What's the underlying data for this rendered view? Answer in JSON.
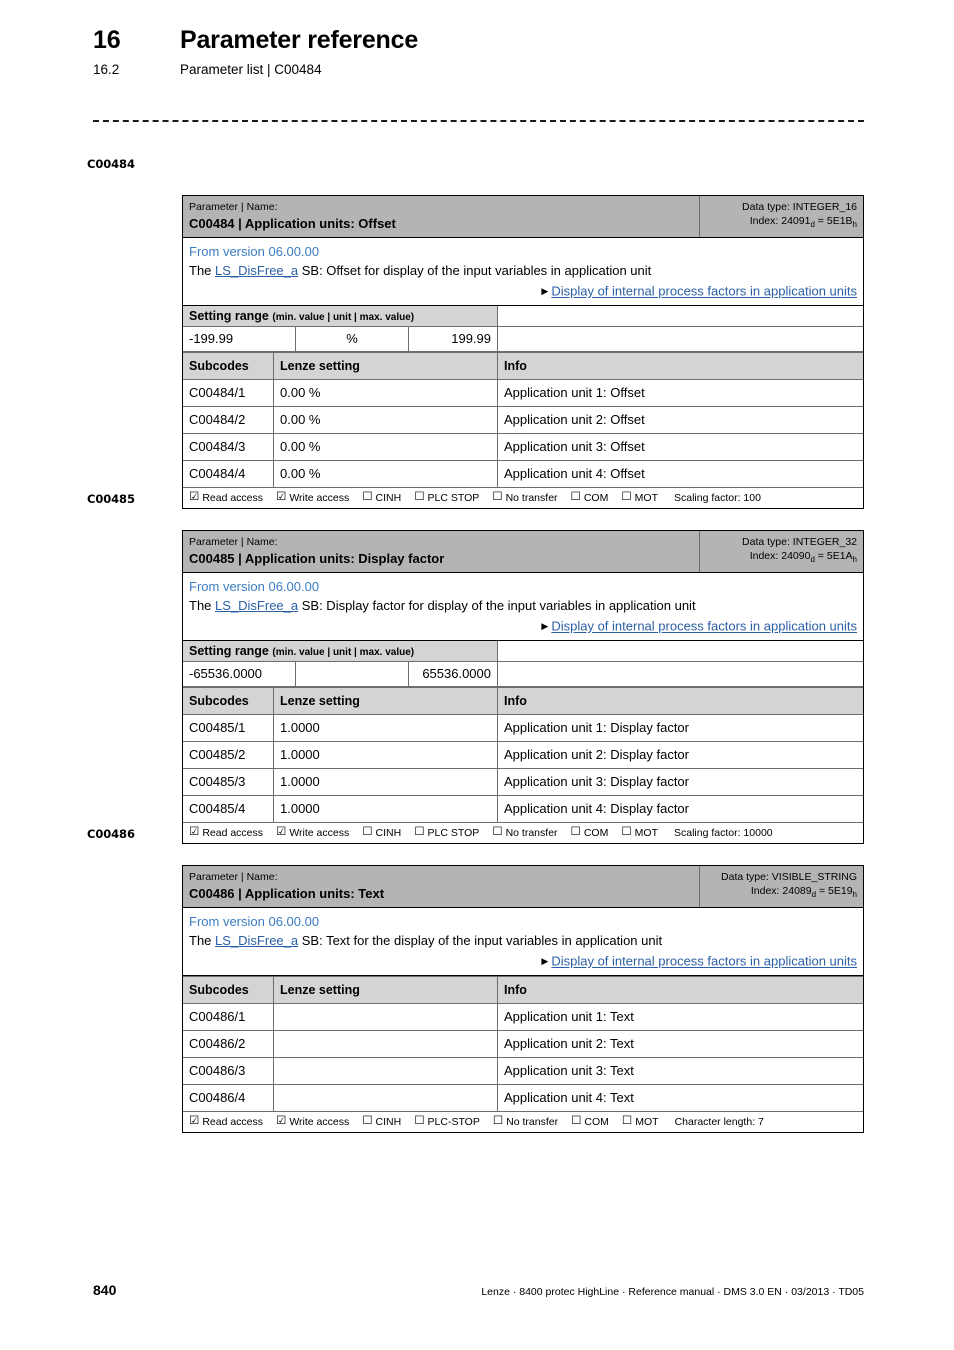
{
  "header": {
    "chapter_number": "16",
    "chapter_title": "Parameter reference",
    "section_number": "16.2",
    "section_title": "Parameter list | C00484"
  },
  "colors": {
    "link_blue": "#2a5fa5",
    "version_blue": "#3b7cc4",
    "head_gray": "#b4b4b4",
    "subhead_gray": "#d4d4d4"
  },
  "blocks": [
    {
      "margin_label": "C00484",
      "head": {
        "kicker": "Parameter | Name:",
        "title": "C00484 | Application units: Offset",
        "data_type_label": "Data type: INTEGER_16",
        "index_prefix": "Index: ",
        "index_dec": "24091",
        "index_dec_sub": "d",
        "index_eq": " = ",
        "index_hex": "5E1B",
        "index_hex_sub": "h"
      },
      "description": {
        "version": "From version 06.00.00",
        "sentence_pre": "The ",
        "sb_link": "LS_DisFree_a",
        "sentence_post": " SB: Offset for display of the input variables in application unit",
        "xref": "Display of internal process factors in application units"
      },
      "setting_range": {
        "label": "Setting range",
        "sublabel": "(min. value | unit | max. value)",
        "min": "-199.99",
        "unit": "%",
        "max": "199.99"
      },
      "subcodes": {
        "columns": [
          "Subcodes",
          "Lenze setting",
          "Info"
        ],
        "rows": [
          [
            "C00484/1",
            "0.00 %",
            "Application unit 1: Offset"
          ],
          [
            "C00484/2",
            "0.00 %",
            "Application unit 2: Offset"
          ],
          [
            "C00484/3",
            "0.00 %",
            "Application unit 3: Offset"
          ],
          [
            "C00484/4",
            "0.00 %",
            "Application unit 4: Offset"
          ]
        ]
      },
      "access": {
        "items": [
          {
            "checked": true,
            "label": "Read access"
          },
          {
            "checked": true,
            "label": "Write access"
          },
          {
            "checked": false,
            "label": "CINH"
          },
          {
            "checked": false,
            "label": "PLC STOP"
          },
          {
            "checked": false,
            "label": "No transfer"
          },
          {
            "checked": false,
            "label": "COM"
          },
          {
            "checked": false,
            "label": "MOT"
          }
        ],
        "note": "Scaling factor: 100"
      }
    },
    {
      "margin_label": "C00485",
      "head": {
        "kicker": "Parameter | Name:",
        "title": "C00485 | Application units: Display factor",
        "data_type_label": "Data type: INTEGER_32",
        "index_prefix": "Index: ",
        "index_dec": "24090",
        "index_dec_sub": "d",
        "index_eq": " = ",
        "index_hex": "5E1A",
        "index_hex_sub": "h"
      },
      "description": {
        "version": "From version 06.00.00",
        "sentence_pre": "The ",
        "sb_link": "LS_DisFree_a",
        "sentence_post": " SB: Display factor for display of the input variables in application unit",
        "xref": "Display of internal process factors in application units"
      },
      "setting_range": {
        "label": "Setting range",
        "sublabel": "(min. value | unit | max. value)",
        "min": "-65536.0000",
        "unit": "",
        "max": "65536.0000"
      },
      "subcodes": {
        "columns": [
          "Subcodes",
          "Lenze setting",
          "Info"
        ],
        "rows": [
          [
            "C00485/1",
            "1.0000",
            "Application unit 1: Display factor"
          ],
          [
            "C00485/2",
            "1.0000",
            "Application unit 2: Display factor"
          ],
          [
            "C00485/3",
            "1.0000",
            "Application unit 3: Display factor"
          ],
          [
            "C00485/4",
            "1.0000",
            "Application unit 4: Display factor"
          ]
        ]
      },
      "access": {
        "items": [
          {
            "checked": true,
            "label": "Read access"
          },
          {
            "checked": true,
            "label": "Write access"
          },
          {
            "checked": false,
            "label": "CINH"
          },
          {
            "checked": false,
            "label": "PLC STOP"
          },
          {
            "checked": false,
            "label": "No transfer"
          },
          {
            "checked": false,
            "label": "COM"
          },
          {
            "checked": false,
            "label": "MOT"
          }
        ],
        "note": "Scaling factor: 10000"
      }
    },
    {
      "margin_label": "C00486",
      "head": {
        "kicker": "Parameter | Name:",
        "title": "C00486 | Application units: Text",
        "data_type_label": "Data type: VISIBLE_STRING",
        "index_prefix": "Index: ",
        "index_dec": "24089",
        "index_dec_sub": "d",
        "index_eq": " = ",
        "index_hex": "5E19",
        "index_hex_sub": "h"
      },
      "description": {
        "version": "From version 06.00.00",
        "sentence_pre": "The ",
        "sb_link": "LS_DisFree_a",
        "sentence_post": " SB: Text for the display of the input variables in application unit",
        "xref": "Display of internal process factors in application units"
      },
      "setting_range": null,
      "subcodes": {
        "columns": [
          "Subcodes",
          "Lenze setting",
          "Info"
        ],
        "rows": [
          [
            "C00486/1",
            "",
            "Application unit 1: Text"
          ],
          [
            "C00486/2",
            "",
            "Application unit 2: Text"
          ],
          [
            "C00486/3",
            "",
            "Application unit 3: Text"
          ],
          [
            "C00486/4",
            "",
            "Application unit 4: Text"
          ]
        ]
      },
      "access": {
        "items": [
          {
            "checked": true,
            "label": "Read access"
          },
          {
            "checked": true,
            "label": "Write access"
          },
          {
            "checked": false,
            "label": "CINH"
          },
          {
            "checked": false,
            "label": "PLC-STOP"
          },
          {
            "checked": false,
            "label": "No transfer"
          },
          {
            "checked": false,
            "label": "COM"
          },
          {
            "checked": false,
            "label": "MOT"
          }
        ],
        "note": "Character length: 7"
      }
    }
  ],
  "footer": {
    "page_number": "840",
    "imprint": "Lenze · 8400 protec HighLine · Reference manual · DMS 3.0 EN · 03/2013 · TD05"
  },
  "icons": {
    "checked_box": "☑",
    "unchecked_box": "☐",
    "xref_arrow": "▶"
  }
}
